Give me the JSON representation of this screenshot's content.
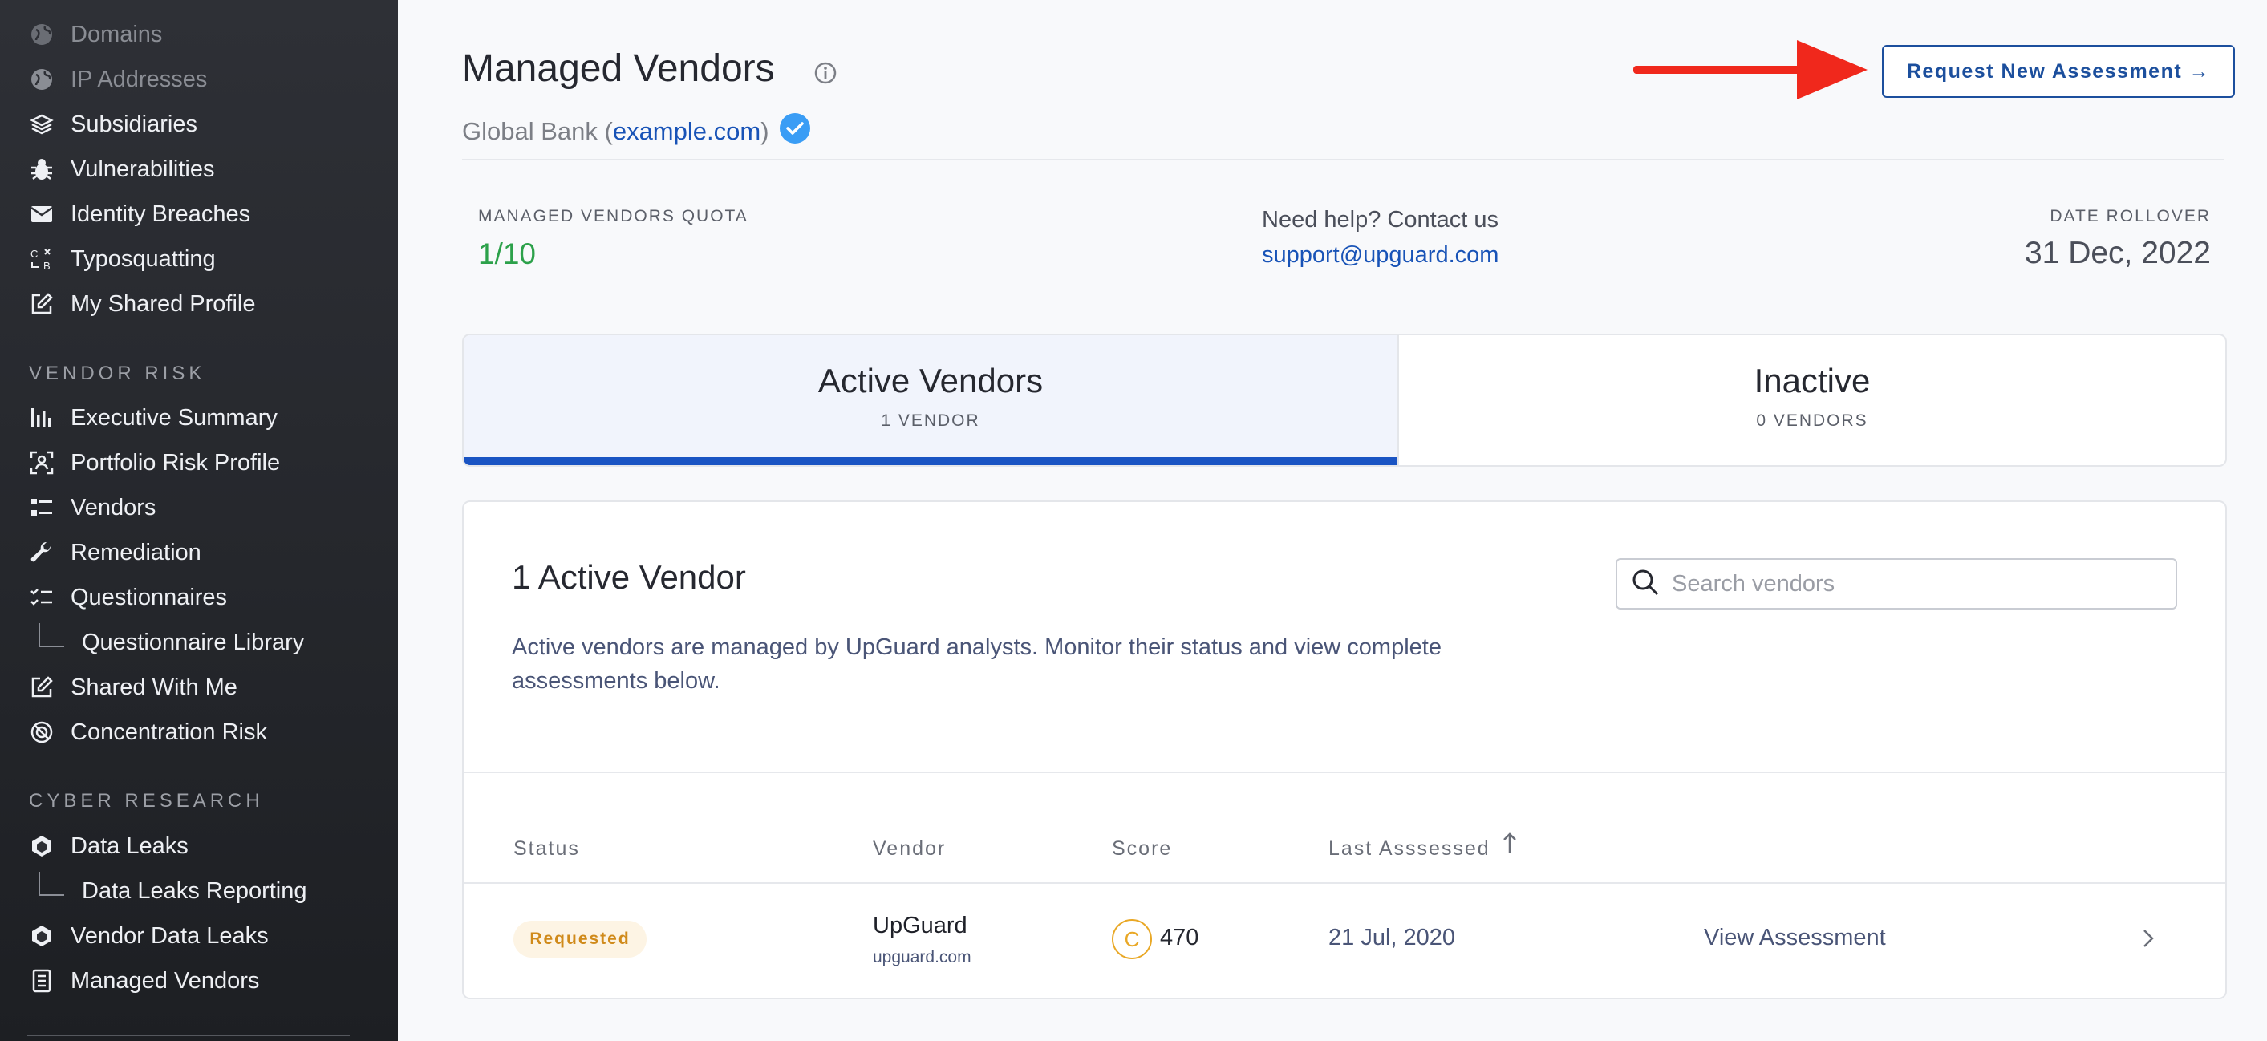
{
  "sidebar": {
    "top_items": [
      {
        "label": "Domains",
        "icon": "globe-icon"
      },
      {
        "label": "IP Addresses",
        "icon": "globe-icon"
      },
      {
        "label": "Subsidiaries",
        "icon": "layers-icon"
      },
      {
        "label": "Vulnerabilities",
        "icon": "bug-icon"
      },
      {
        "label": "Identity Breaches",
        "icon": "envelope-icon"
      },
      {
        "label": "Typosquatting",
        "icon": "typosquat-icon"
      },
      {
        "label": "My Shared Profile",
        "icon": "edit-icon"
      }
    ],
    "vendor_risk_section": "VENDOR RISK",
    "vendor_risk_items": [
      {
        "label": "Executive Summary",
        "icon": "bar-chart-icon"
      },
      {
        "label": "Portfolio Risk Profile",
        "icon": "scan-icon"
      },
      {
        "label": "Vendors",
        "icon": "list-icon"
      },
      {
        "label": "Remediation",
        "icon": "wrench-icon"
      },
      {
        "label": "Questionnaires",
        "icon": "checklist-icon"
      },
      {
        "label": "Questionnaire Library",
        "icon": "tree-branch"
      },
      {
        "label": "Shared With Me",
        "icon": "edit-icon"
      },
      {
        "label": "Concentration Risk",
        "icon": "concentration-icon"
      }
    ],
    "cyber_research_section": "CYBER RESEARCH",
    "cyber_research_items": [
      {
        "label": "Data Leaks",
        "icon": "cube-icon"
      },
      {
        "label": "Data Leaks Reporting",
        "icon": "tree-branch"
      },
      {
        "label": "Vendor Data Leaks",
        "icon": "cube-icon"
      },
      {
        "label": "Managed Vendors",
        "icon": "document-icon"
      }
    ]
  },
  "header": {
    "title": "Managed Vendors",
    "subtitle_prefix": "Global Bank (",
    "subtitle_link": "example.com",
    "subtitle_suffix": ")",
    "request_button": "Request New Assessment →"
  },
  "stats": {
    "quota_label": "MANAGED VENDORS QUOTA",
    "quota_value": "1/10",
    "help_label": "Need help? Contact us",
    "help_email": "support@upguard.com",
    "rollover_label": "DATE ROLLOVER",
    "rollover_value": "31 Dec, 2022"
  },
  "tabs": [
    {
      "title": "Active Vendors",
      "count": "1 VENDOR"
    },
    {
      "title": "Inactive",
      "count": "0 VENDORS"
    }
  ],
  "card": {
    "title": "1 Active Vendor",
    "description": "Active vendors are managed by UpGuard analysts. Monitor their status and view complete assessments below.",
    "search_placeholder": "Search vendors",
    "columns": [
      "Status",
      "Vendor",
      "Score",
      "Last Asssessed"
    ],
    "rows": [
      {
        "status": "Requested",
        "vendor": "UpGuard",
        "domain": "upguard.com",
        "grade": "C",
        "score": "470",
        "last_assessed": "21 Jul, 2020",
        "action": "View Assessment"
      }
    ]
  },
  "colors": {
    "accent": "#1a54c3",
    "quota_green": "#2ca14a",
    "annotation_arrow": "#f0281c",
    "status_orange": "#d08a1a"
  }
}
